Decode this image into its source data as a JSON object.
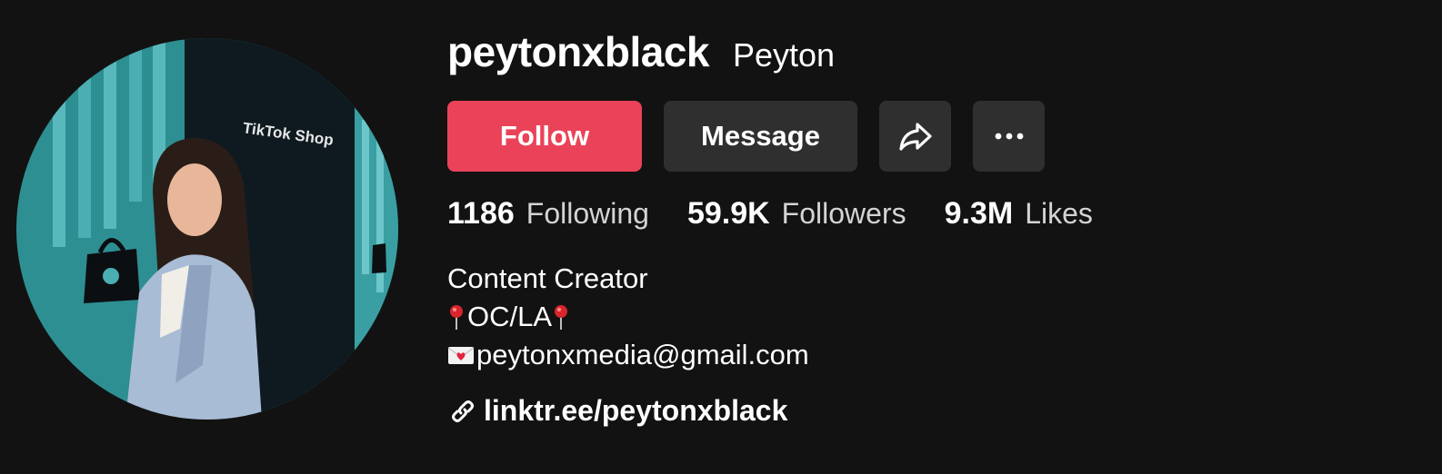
{
  "profile": {
    "username": "peytonxblack",
    "nickname": "Peyton"
  },
  "actions": {
    "follow_label": "Follow",
    "message_label": "Message",
    "share_icon": "share-arrow-icon",
    "more_icon": "more-dots-icon"
  },
  "stats": [
    {
      "value": "1186",
      "label": "Following"
    },
    {
      "value": "59.9K",
      "label": "Followers"
    },
    {
      "value": "9.3M",
      "label": "Likes"
    }
  ],
  "bio": {
    "line1": "Content Creator",
    "line2": "OC/LA",
    "line3": "peytonxmedia@gmail.com"
  },
  "link": {
    "text": "linktr.ee/peytonxblack",
    "icon": "link-icon"
  },
  "avatar_sign_text": "TikTok Shop",
  "colors": {
    "background": "#121212",
    "follow_button": "#ea4359",
    "secondary_button": "#2f2f2f",
    "muted_text": "#d4d4d4"
  }
}
